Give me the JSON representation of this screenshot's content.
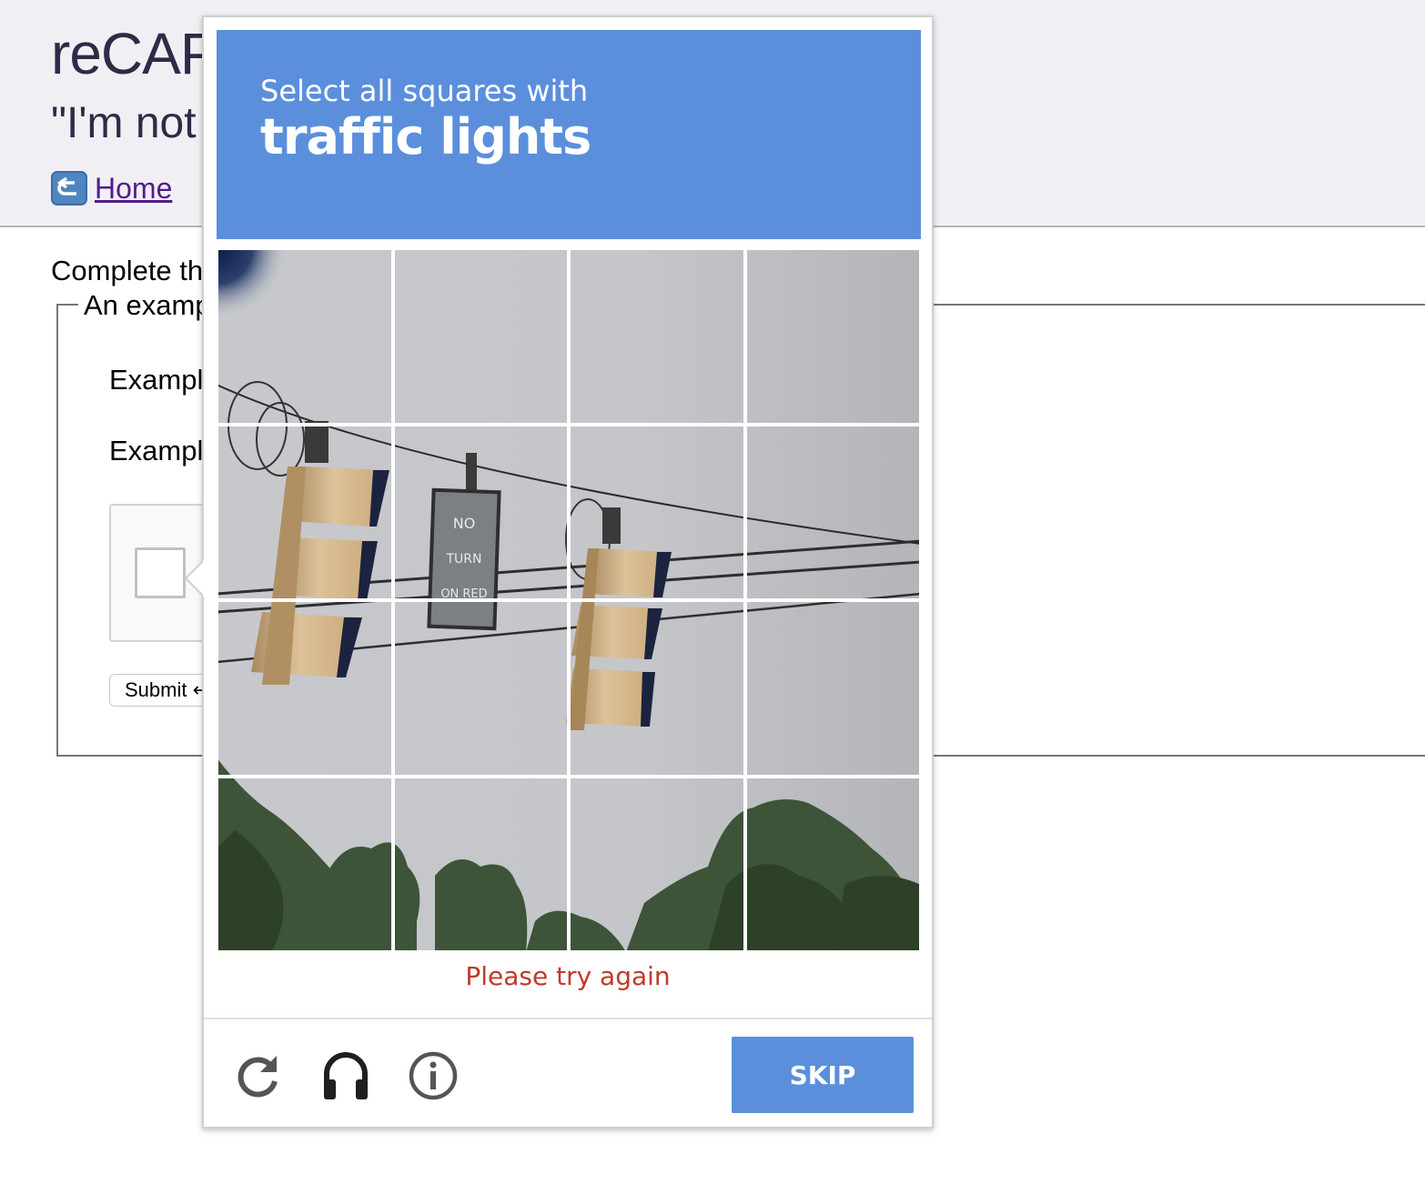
{
  "page": {
    "title": "reCAP",
    "subtitle": "\"I'm not",
    "home_link": "Home",
    "intro": "Complete th",
    "legend": "An examp",
    "field_1": "Exampl",
    "field_2": "Exampl",
    "submit_label": "Submit ↵"
  },
  "captcha": {
    "instruction": "Select all squares with",
    "target": "traffic lights",
    "error": "Please try again",
    "skip_label": "SKIP",
    "accent_color": "#5b8fdc",
    "error_color": "#c0392b",
    "tiles": [
      {
        "row": 1,
        "col": 1
      },
      {
        "row": 1,
        "col": 2
      },
      {
        "row": 1,
        "col": 3
      },
      {
        "row": 1,
        "col": 4
      },
      {
        "row": 2,
        "col": 1
      },
      {
        "row": 2,
        "col": 2
      },
      {
        "row": 2,
        "col": 3
      },
      {
        "row": 2,
        "col": 4
      },
      {
        "row": 3,
        "col": 1
      },
      {
        "row": 3,
        "col": 2
      },
      {
        "row": 3,
        "col": 3
      },
      {
        "row": 3,
        "col": 4
      },
      {
        "row": 4,
        "col": 1
      },
      {
        "row": 4,
        "col": 2
      },
      {
        "row": 4,
        "col": 3
      },
      {
        "row": 4,
        "col": 4
      }
    ],
    "footer_icons": [
      "reload-icon",
      "headphones-icon",
      "info-icon"
    ],
    "sign_text": [
      "NO",
      "TURN",
      "ON RED"
    ]
  }
}
